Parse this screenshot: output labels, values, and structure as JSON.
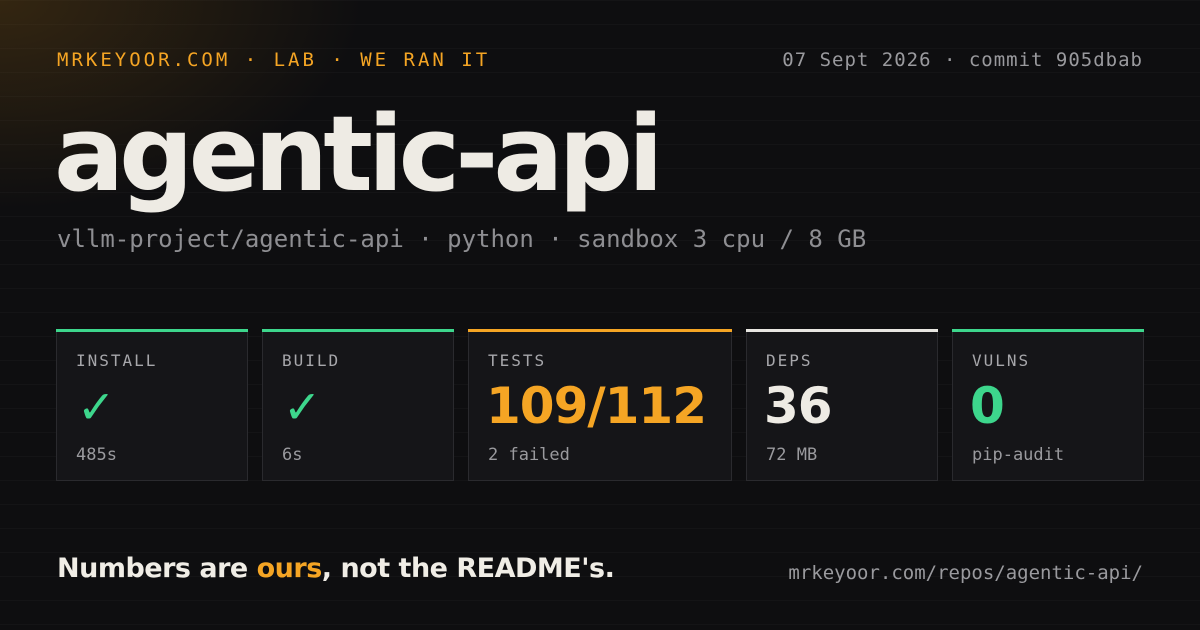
{
  "header": {
    "kicker": "MRKEYOOR.COM · LAB · WE RAN IT",
    "date_commit": "07 Sept 2026 · commit 905dbab"
  },
  "title": "agentic-api",
  "subtitle": "vllm-project/agentic-api · python · sandbox 3 cpu / 8 GB",
  "cards": [
    {
      "label": "INSTALL",
      "value": "✓",
      "note": "485s",
      "accent": "#3dd68c",
      "value_color": "#3dd68c",
      "icon": "check-icon"
    },
    {
      "label": "BUILD",
      "value": "✓",
      "note": "6s",
      "accent": "#3dd68c",
      "value_color": "#3dd68c",
      "icon": "check-icon"
    },
    {
      "label": "TESTS",
      "value": "109/112",
      "note": "2 failed",
      "accent": "#f5a524",
      "value_color": "#f5a524"
    },
    {
      "label": "DEPS",
      "value": "36",
      "note": "72 MB",
      "accent": "#e8e6e1",
      "value_color": "#eeebe4"
    },
    {
      "label": "VULNS",
      "value": "0",
      "note": "pip-audit",
      "accent": "#3dd68c",
      "value_color": "#3dd68c"
    }
  ],
  "footer": {
    "tagline_pre": "Numbers are ",
    "tagline_highlight": "ours",
    "tagline_post": ", not the README's.",
    "url": "mrkeyoor.com/repos/agentic-api/"
  },
  "colors": {
    "background": "#0e0e10",
    "accent_amber": "#f5a524",
    "accent_green": "#3dd68c"
  }
}
